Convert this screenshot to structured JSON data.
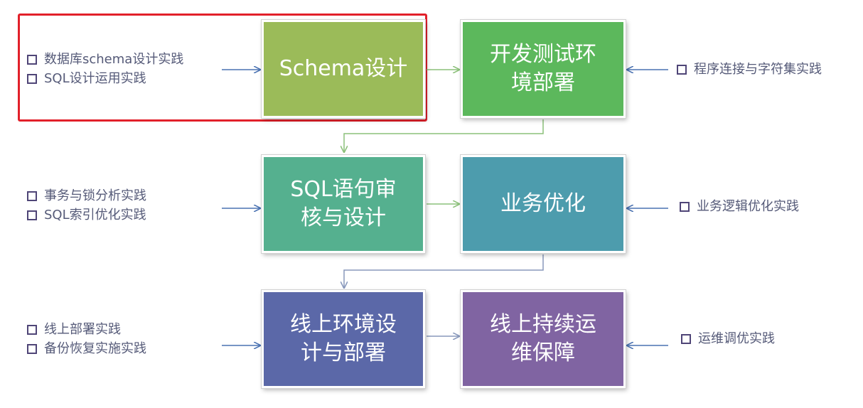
{
  "colors": {
    "schema": "#9bbb59",
    "dev_env": "#5cb85c",
    "sql_review": "#55b08f",
    "business": "#4d9cad",
    "online_env": "#5b68a8",
    "ops": "#8064a2",
    "highlight": "#e2202a",
    "arrow_blue": "#4a72b2",
    "arrow_green": "#8cc07a",
    "arrow_gray": "#8898bb",
    "note_text": "#555a78"
  },
  "boxes": {
    "schema": "Schema设计",
    "dev_env": {
      "line1": "开发测试环",
      "line2": "境部署"
    },
    "sql_review": {
      "line1": "SQL语句审",
      "line2": "核与设计"
    },
    "business": "业务优化",
    "online_env": {
      "line1": "线上环境设",
      "line2": "计与部署"
    },
    "ops": {
      "line1": "线上持续运",
      "line2": "维保障"
    }
  },
  "notes": {
    "schema": [
      "数据库schema设计实践",
      "SQL设计运用实践"
    ],
    "dev_env": [
      "程序连接与字符集实践"
    ],
    "sql_review": [
      "事务与锁分析实践",
      "SQL索引优化实践"
    ],
    "business": [
      "业务逻辑优化实践"
    ],
    "online_env": [
      "线上部署实践",
      "备份恢复实施实践"
    ],
    "ops": [
      "运维调优实践"
    ]
  }
}
